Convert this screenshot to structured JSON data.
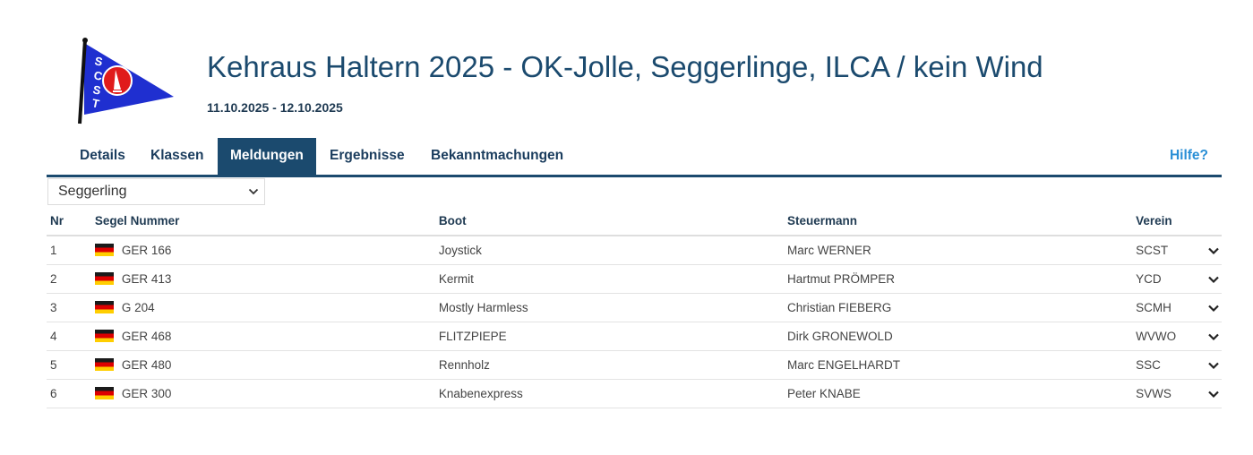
{
  "header": {
    "title": "Kehraus Haltern 2025 - OK-Jolle, Seggerlinge, ILCA / kein Wind",
    "dates": "11.10.2025 - 12.10.2025",
    "logo_text": "SCST"
  },
  "nav": {
    "tabs": [
      {
        "label": "Details"
      },
      {
        "label": "Klassen"
      },
      {
        "label": "Meldungen"
      },
      {
        "label": "Ergebnisse"
      },
      {
        "label": "Bekanntmachungen"
      }
    ],
    "active_tab": "Meldungen",
    "help": "Hilfe?"
  },
  "class_select": {
    "value": "Seggerling"
  },
  "table": {
    "headers": [
      "Nr",
      "Segel Nummer",
      "Boot",
      "Steuermann",
      "Verein"
    ],
    "rows": [
      {
        "nr": "1",
        "sail": "GER 166",
        "boat": "Joystick",
        "skipper": "Marc WERNER",
        "club": "SCST"
      },
      {
        "nr": "2",
        "sail": "GER 413",
        "boat": "Kermit",
        "skipper": "Hartmut PRÖMPER",
        "club": "YCD"
      },
      {
        "nr": "3",
        "sail": "G 204",
        "boat": "Mostly Harmless",
        "skipper": "Christian FIEBERG",
        "club": "SCMH"
      },
      {
        "nr": "4",
        "sail": "GER 468",
        "boat": "FLITZPIEPE",
        "skipper": "Dirk GRONEWOLD",
        "club": "WVWO"
      },
      {
        "nr": "5",
        "sail": "GER 480",
        "boat": "Rennholz",
        "skipper": "Marc ENGELHARDT",
        "club": "SSC"
      },
      {
        "nr": "6",
        "sail": "GER 300",
        "boat": "Knabenexpress",
        "skipper": "Peter KNABE",
        "club": "SVWS"
      }
    ]
  },
  "colors": {
    "primary": "#1b4a6e",
    "link": "#2a8fd6",
    "burgee_blue": "#1f2fd0",
    "burgee_red": "#e01b1b"
  },
  "icons": {
    "row_expand": "chevron-down-icon",
    "flag": "germany-flag-icon"
  }
}
